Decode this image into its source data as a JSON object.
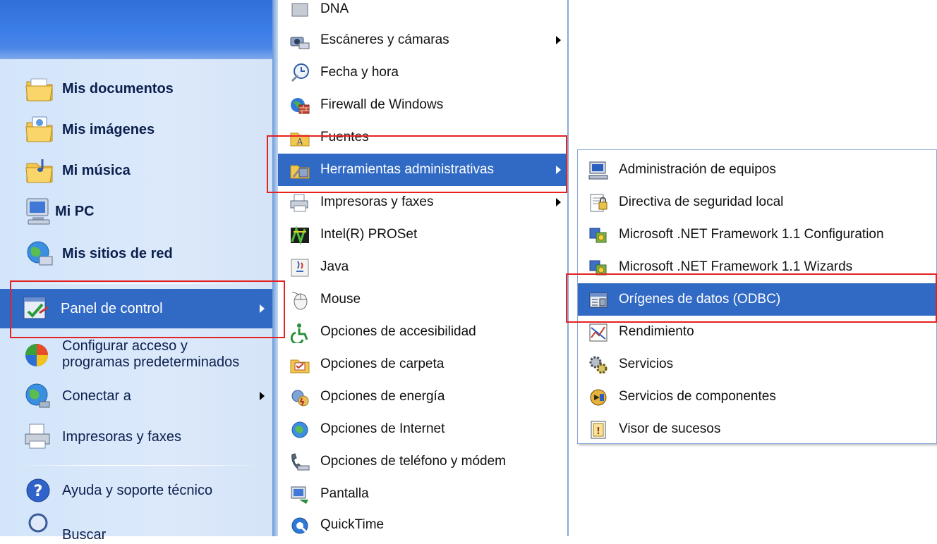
{
  "left_menu": {
    "items": [
      {
        "key": "mis-documentos",
        "label": "Mis documentos",
        "bold": true,
        "icon": "folder-documents-icon"
      },
      {
        "key": "mis-imagenes",
        "label": "Mis imágenes",
        "bold": true,
        "icon": "folder-pictures-icon"
      },
      {
        "key": "mi-musica",
        "label": "Mi música",
        "bold": true,
        "icon": "folder-music-icon"
      },
      {
        "key": "mi-pc",
        "label": "Mi PC",
        "bold": true,
        "icon": "computer-icon"
      },
      {
        "key": "mis-sitios-red",
        "label": "Mis sitios de red",
        "bold": true,
        "icon": "network-places-icon"
      },
      {
        "key": "panel-control",
        "label": "Panel de control",
        "bold": false,
        "icon": "control-panel-icon",
        "selected": true,
        "submenu": true
      },
      {
        "key": "configurar-acceso",
        "label_line1": "Configurar acceso y",
        "label_line2": "programas predeterminados",
        "bold": false,
        "icon": "default-programs-icon"
      },
      {
        "key": "conectar-a",
        "label": "Conectar a",
        "bold": false,
        "icon": "connect-to-icon",
        "submenu": true
      },
      {
        "key": "impresoras-faxes",
        "label": "Impresoras y faxes",
        "bold": false,
        "icon": "printer-icon"
      },
      {
        "key": "ayuda",
        "label": "Ayuda y soporte técnico",
        "bold": false,
        "icon": "help-icon"
      },
      {
        "key": "buscar",
        "label": "Buscar",
        "bold": false,
        "icon": "search-icon"
      }
    ]
  },
  "control_panel_menu": {
    "items": [
      {
        "label": "DNA",
        "icon": "dna-icon"
      },
      {
        "label": "Escáneres y cámaras",
        "icon": "scanner-camera-icon",
        "submenu": true
      },
      {
        "label": "Fecha y hora",
        "icon": "date-time-icon"
      },
      {
        "label": "Firewall de Windows",
        "icon": "firewall-icon"
      },
      {
        "label": "Fuentes",
        "icon": "fonts-folder-icon"
      },
      {
        "label": "Herramientas administrativas",
        "icon": "admin-tools-icon",
        "selected": true,
        "submenu": true
      },
      {
        "label": "Impresoras y faxes",
        "icon": "printer-fax-icon",
        "submenu": true
      },
      {
        "label": "Intel(R) PROSet",
        "icon": "intel-proset-icon"
      },
      {
        "label": "Java",
        "icon": "java-icon"
      },
      {
        "label": "Mouse",
        "icon": "mouse-icon"
      },
      {
        "label": "Opciones de accesibilidad",
        "icon": "accessibility-icon"
      },
      {
        "label": "Opciones de carpeta",
        "icon": "folder-options-icon"
      },
      {
        "label": "Opciones de energía",
        "icon": "power-options-icon"
      },
      {
        "label": "Opciones de Internet",
        "icon": "internet-options-icon"
      },
      {
        "label": "Opciones de teléfono y módem",
        "icon": "phone-modem-icon"
      },
      {
        "label": "Pantalla",
        "icon": "display-icon"
      },
      {
        "label": "QuickTime",
        "icon": "quicktime-icon"
      }
    ]
  },
  "admin_tools_menu": {
    "items": [
      {
        "label": "Administración de equipos",
        "icon": "computer-management-icon"
      },
      {
        "label": "Directiva de seguridad local",
        "icon": "security-policy-icon"
      },
      {
        "label": "Microsoft .NET Framework 1.1 Configuration",
        "icon": "dotnet-config-icon"
      },
      {
        "label": "Microsoft .NET Framework 1.1 Wizards",
        "icon": "dotnet-wizards-icon"
      },
      {
        "label": "Orígenes de datos (ODBC)",
        "icon": "odbc-icon",
        "selected": true
      },
      {
        "label": "Rendimiento",
        "icon": "performance-icon"
      },
      {
        "label": "Servicios",
        "icon": "services-icon"
      },
      {
        "label": "Servicios de componentes",
        "icon": "component-services-icon"
      },
      {
        "label": "Visor de sucesos",
        "icon": "event-viewer-icon"
      }
    ]
  },
  "colors": {
    "selection": "#316ac5",
    "highlight_box": "#e52222",
    "left_panel_bg": "#d3e5fa",
    "title_band": "#3d7ee8"
  }
}
